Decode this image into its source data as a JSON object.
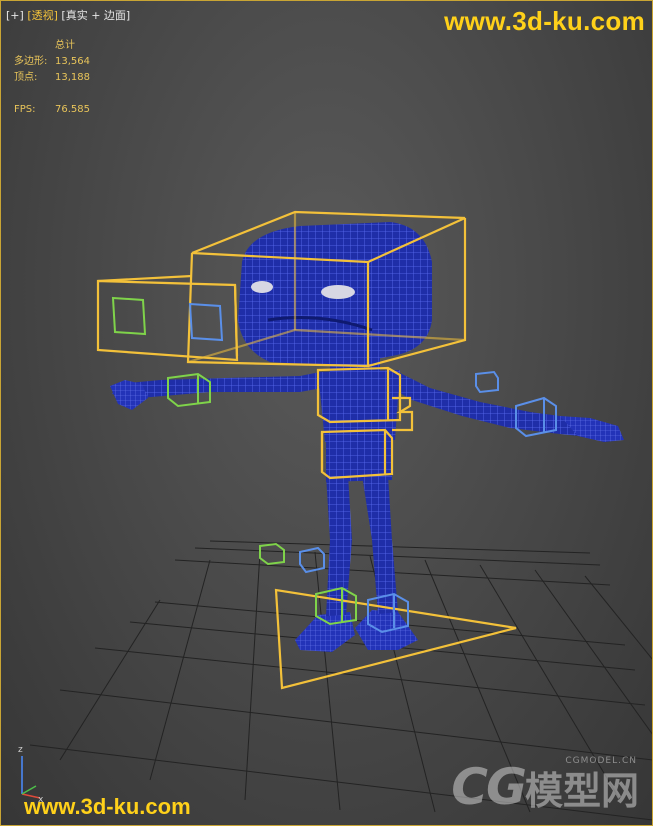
{
  "viewport_label": {
    "plus": "[+]",
    "view": "[透视]",
    "shading": "[真实 + 边面]"
  },
  "stats": {
    "title": "总计",
    "polys_label": "多边形:",
    "polys_value": "13,564",
    "verts_label": "顶点:",
    "verts_value": "13,188",
    "fps_label": "FPS:",
    "fps_value": "76.585"
  },
  "watermarks": {
    "top": "www.3d-ku.com",
    "bottom": "www.3d-ku.com",
    "cg_logo": "CG",
    "cg_chinese": "模型网",
    "cg_domain": "CGMODEL.CN"
  },
  "axis": {
    "z": "z",
    "x": "x"
  },
  "colors": {
    "viewport_border": "#c9a534",
    "rig_controls": "#f3c13a",
    "ik_left": "#7fd34a",
    "ik_right": "#5a8fe8",
    "mesh_fill": "#1f2ea8",
    "mesh_wire": "#5c6df2",
    "grid": "#232323"
  },
  "icons": [
    "axis-gizmo-icon",
    "cg-logo-icon"
  ]
}
